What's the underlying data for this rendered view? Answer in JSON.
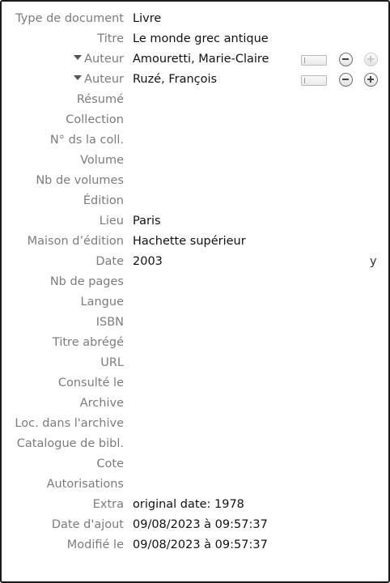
{
  "fields": {
    "type_document": {
      "label": "Type de document",
      "value": "Livre"
    },
    "titre": {
      "label": "Titre",
      "value": "Le monde grec antique"
    },
    "auteur1": {
      "label": "Auteur",
      "value": "Amouretti, Marie-Claire"
    },
    "auteur2": {
      "label": "Auteur",
      "value": "Ruzé, François"
    },
    "resume": {
      "label": "Résumé",
      "value": ""
    },
    "collection": {
      "label": "Collection",
      "value": ""
    },
    "num_coll": {
      "label": "N° ds la coll.",
      "value": ""
    },
    "volume": {
      "label": "Volume",
      "value": ""
    },
    "nb_volumes": {
      "label": "Nb de volumes",
      "value": ""
    },
    "edition": {
      "label": "Édition",
      "value": ""
    },
    "lieu": {
      "label": "Lieu",
      "value": "Paris"
    },
    "maison_edition": {
      "label": "Maison d’édition",
      "value": "Hachette supérieur"
    },
    "date": {
      "label": "Date",
      "value": "2003",
      "suffix": "y"
    },
    "nb_pages": {
      "label": "Nb de pages",
      "value": ""
    },
    "langue": {
      "label": "Langue",
      "value": ""
    },
    "isbn": {
      "label": "ISBN",
      "value": ""
    },
    "titre_abrege": {
      "label": "Titre abrégé",
      "value": ""
    },
    "url": {
      "label": "URL",
      "value": ""
    },
    "consulte_le": {
      "label": "Consulté le",
      "value": ""
    },
    "archive": {
      "label": "Archive",
      "value": ""
    },
    "loc_archive": {
      "label": "Loc. dans l'archive",
      "value": ""
    },
    "catalogue": {
      "label": "Catalogue de bibl.",
      "value": ""
    },
    "cote": {
      "label": "Cote",
      "value": ""
    },
    "autorisations": {
      "label": "Autorisations",
      "value": ""
    },
    "extra": {
      "label": "Extra",
      "value": "original date: 1978"
    },
    "date_ajout": {
      "label": "Date d'ajout",
      "value": "09/08/2023 à 09:57:37"
    },
    "modifie_le": {
      "label": "Modifié le",
      "value": "09/08/2023 à 09:57:37"
    }
  },
  "icons": {
    "creator_menu": "disclosure-triangle-icon",
    "name_mode": "name-mode-switch-icon",
    "remove": "minus-circle-icon",
    "add": "plus-circle-icon"
  },
  "colors": {
    "label": "#7c7c7c",
    "value": "#111111",
    "border": "#1a1a1a"
  }
}
